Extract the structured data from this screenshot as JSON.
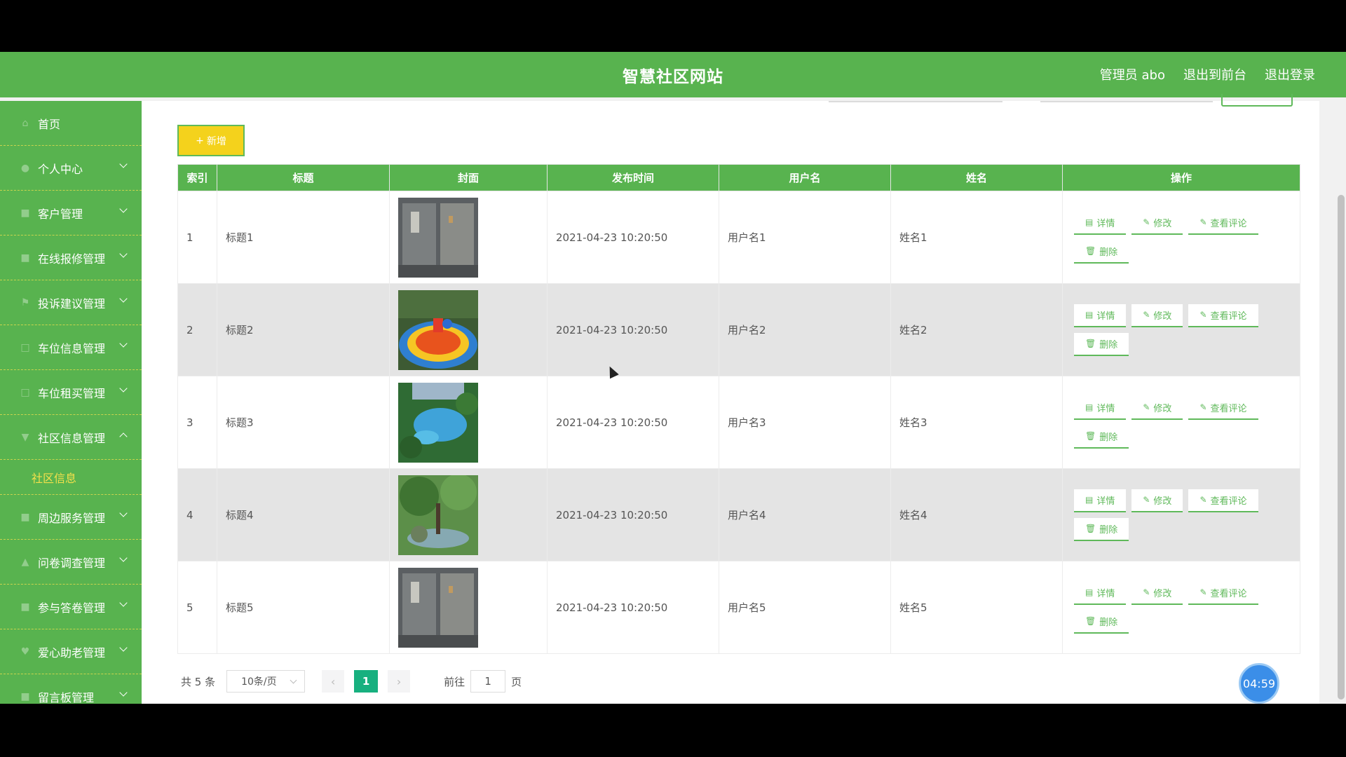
{
  "header": {
    "title": "智慧社区网站",
    "user": "管理员 abo",
    "to_front": "退出到前台",
    "logout": "退出登录"
  },
  "sidebar": {
    "items": [
      {
        "label": "首页",
        "icon": "home-icon"
      },
      {
        "label": "个人中心",
        "icon": "user-icon"
      },
      {
        "label": "客户管理",
        "icon": "customer-icon"
      },
      {
        "label": "在线报修管理",
        "icon": "repair-icon"
      },
      {
        "label": "投诉建议管理",
        "icon": "flag-icon"
      },
      {
        "label": "车位信息管理",
        "icon": "parking-icon"
      },
      {
        "label": "车位租买管理",
        "icon": "car-icon"
      },
      {
        "label": "社区信息管理",
        "icon": "info-icon"
      },
      {
        "label": "周边服务管理",
        "icon": "service-icon"
      },
      {
        "label": "问卷调查管理",
        "icon": "survey-icon"
      },
      {
        "label": "参与答卷管理",
        "icon": "answer-icon"
      },
      {
        "label": "爱心助老管理",
        "icon": "heart-icon"
      },
      {
        "label": "留言板管理",
        "icon": "message-icon"
      }
    ],
    "sub_active": "社区信息"
  },
  "toolbar": {
    "add_label": "新增"
  },
  "table": {
    "headers": [
      "索引",
      "标题",
      "封面",
      "发布时间",
      "用户名",
      "姓名",
      "操作"
    ],
    "rows": [
      {
        "index": "1",
        "title": "标题1",
        "time": "2021-04-23 10:20:50",
        "username": "用户名1",
        "name": "姓名1"
      },
      {
        "index": "2",
        "title": "标题2",
        "time": "2021-04-23 10:20:50",
        "username": "用户名2",
        "name": "姓名2"
      },
      {
        "index": "3",
        "title": "标题3",
        "time": "2021-04-23 10:20:50",
        "username": "用户名3",
        "name": "姓名3"
      },
      {
        "index": "4",
        "title": "标题4",
        "time": "2021-04-23 10:20:50",
        "username": "用户名4",
        "name": "姓名4"
      },
      {
        "index": "5",
        "title": "标题5",
        "time": "2021-04-23 10:20:50",
        "username": "用户名5",
        "name": "姓名5"
      }
    ],
    "ops": {
      "detail": "详情",
      "edit": "修改",
      "comments": "查看评论",
      "delete": "删除"
    }
  },
  "pagination": {
    "total": "共 5 条",
    "page_size": "10条/页",
    "current": "1",
    "goto_prefix": "前往",
    "goto_value": "1",
    "goto_suffix": "页"
  },
  "timer": "04:59",
  "colors": {
    "brand": "#58b34f",
    "accent": "#f4d21c",
    "page_active": "#17b07f"
  }
}
